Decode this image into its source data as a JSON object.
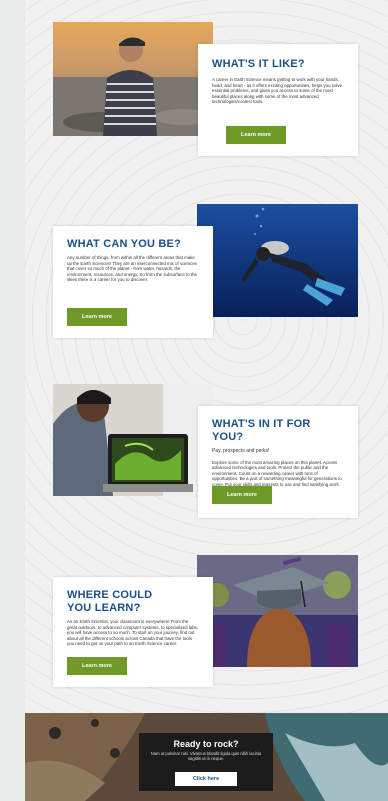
{
  "sections": [
    {
      "title": "WHAT'S IT LIKE?",
      "body": "A career in Earth Science means getting to work with your hands, head, and heart - as it offers exciting opportunities, helps you solve essential problems, and gives you access to some of the most beautiful places along with some of the most advanced technologies/coolest tools.",
      "button": "Learn more",
      "image_alt": "man-in-striped-sweater-photo"
    },
    {
      "title": "WHAT CAN YOU BE?",
      "body": "Any number of things, from within all the different areas that make up the Earth Sciences! They are an interconnected mix of sciences that cover so much of the planet - from water, hazards, the environment, resources, and energy. So from the subsurface to the skies there is a career for you to discover.",
      "button": "Learn more",
      "image_alt": "scuba-diver-photo"
    },
    {
      "title": "WHAT'S IN IT FOR YOU?",
      "subtitle": "Pay, prospects and perks!",
      "body": "Explore some of the most amazing places on this planet. Access advanced technologies and tools. Protect the public and the environment. Count on a rewarding career with tons of opportunities. Be a part of something meaningful for generations to come. Put your skills and interests to use and find satisfying work.",
      "button": "Learn more",
      "image_alt": "student-with-laptop-photo"
    },
    {
      "title": "WHERE COULD YOU LEARN?",
      "body": "As an Earth Scientist, your classroom is everywhere! From the great outdoors, to advanced computer systems, to specialized labs, you will have access to so much. To start on your journey, find out about all the different schools across Canada that have the tools you need to get on your path to an Earth Science career.",
      "button": "Learn more",
      "image_alt": "graduate-cap-photo"
    }
  ],
  "footer": {
    "title": "Ready to rock?",
    "body": "Nam ut pulvinar nisl. Vivamus blandit ligula quis nibh lacinia sagittis ut in neque.",
    "button": "Click here"
  },
  "colors": {
    "heading": "#1b4f8a",
    "button": "#6f9a28"
  }
}
